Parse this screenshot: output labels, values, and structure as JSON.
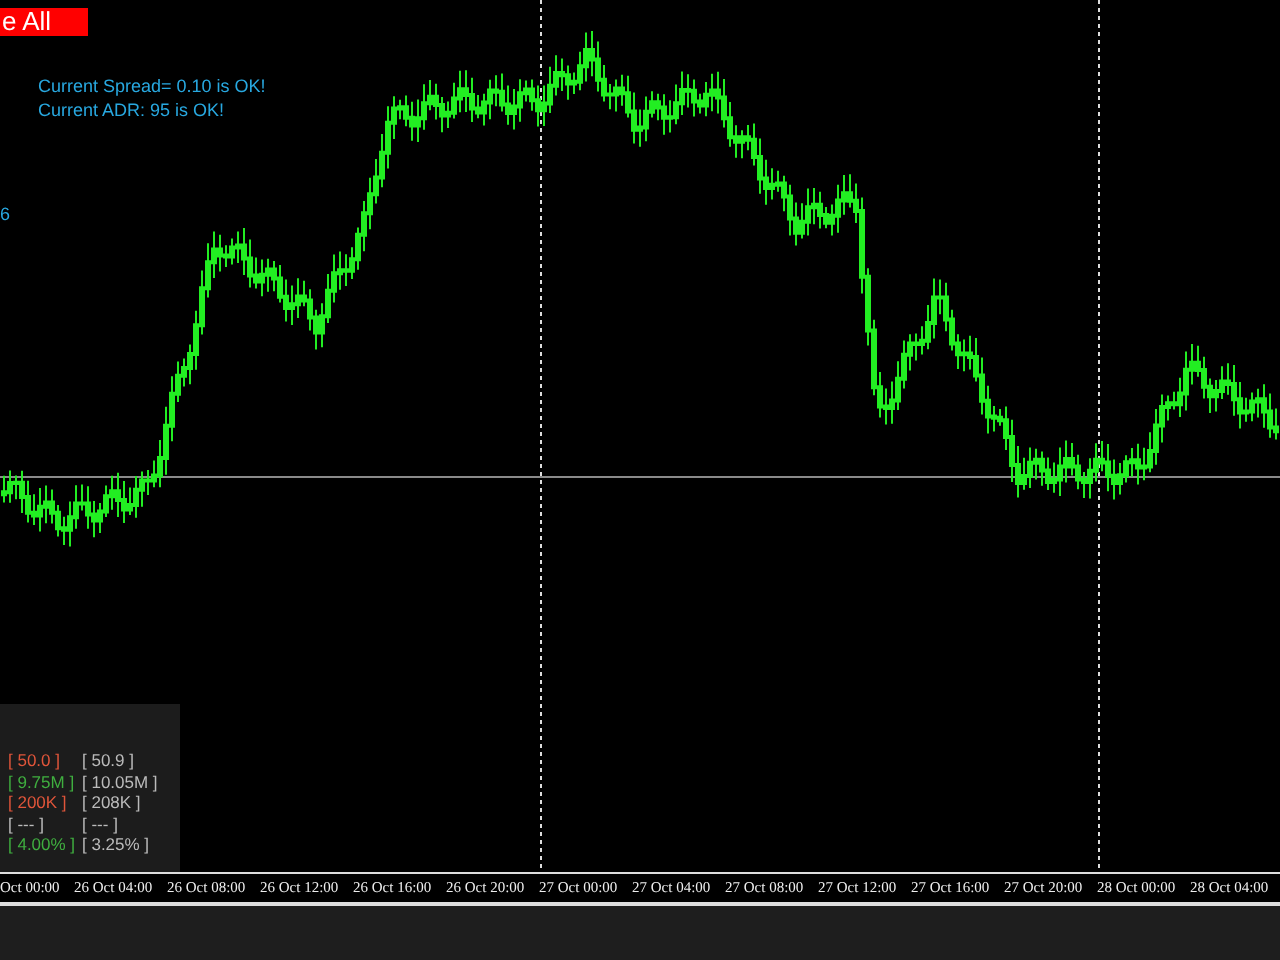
{
  "close_button": {
    "label": "e All"
  },
  "messages": [
    "Current Spread= 0.10 is OK!",
    "Current ADR: 95  is OK!"
  ],
  "side_label": "6",
  "info_panel": {
    "rows": [
      {
        "current": "[ 50.0 ]",
        "color": "#e0553a",
        "reference": "[ 50.9 ]"
      },
      {
        "current": "[ 9.75M ]",
        "color": "#3fae3f",
        "reference": "[ 10.05M ]"
      },
      {
        "current": "[ 200K ]",
        "color": "#e0553a",
        "reference": "[ 208K ]"
      },
      {
        "current": "[ --- ]",
        "color": "#bbbbbb",
        "reference": "[ --- ]"
      },
      {
        "current": "[ 4.00% ]",
        "color": "#3fae3f",
        "reference": "[ 3.25% ]"
      }
    ]
  },
  "time_axis": [
    "Oct 00:00",
    "26 Oct 04:00",
    "26 Oct 08:00",
    "26 Oct 12:00",
    "26 Oct 16:00",
    "26 Oct 20:00",
    "27 Oct 00:00",
    "27 Oct 04:00",
    "27 Oct 08:00",
    "27 Oct 12:00",
    "27 Oct 16:00",
    "27 Oct 20:00",
    "28 Oct 00:00",
    "28 Oct 04:00"
  ]
}
